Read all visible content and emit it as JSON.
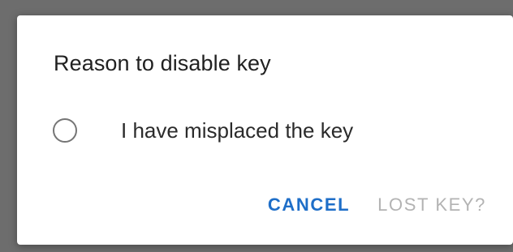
{
  "dialog": {
    "title": "Reason to disable key",
    "options": [
      {
        "label": "I have misplaced the key",
        "selected": false
      }
    ],
    "actions": {
      "cancel_label": "CANCEL",
      "confirm_label": "LOST KEY?",
      "confirm_enabled": false
    }
  },
  "colors": {
    "scrim": "#6d6d6d",
    "dialog_background": "#ffffff",
    "accent": "#1e6ec8",
    "disabled_text": "#b3b3b3",
    "title_text": "#212121"
  },
  "icons": {
    "radio": "radio-unchecked-icon"
  }
}
